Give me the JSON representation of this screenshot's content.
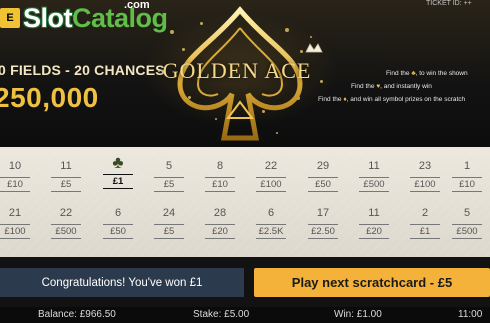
{
  "brand": {
    "tag": "E",
    "name_prefix": "Slot",
    "name_suffix": "Catalog",
    "domain": ".com"
  },
  "ticket_id": "TICKET ID: ++",
  "header": {
    "fields_text": "0 FIELDS - 20 CHANCES",
    "top_prize": "250,000",
    "game_title": "GOLDEN ACE"
  },
  "rules": [
    {
      "pre": "Find the",
      "icon": "♣",
      "post": ", to win the shown"
    },
    {
      "pre": "Find the",
      "icon": "♥",
      "post": ", and instantly win"
    },
    {
      "pre": "Find the",
      "icon": "♦",
      "post": ", and win all symbol prizes on the scratch"
    }
  ],
  "grid": {
    "rows": [
      [
        {
          "symbol": "10",
          "prize": "£10"
        },
        {
          "symbol": "11",
          "prize": "£5"
        },
        {
          "symbol": "♣",
          "prize": "£1",
          "winning": true
        },
        {
          "symbol": "5",
          "prize": "£5"
        },
        {
          "symbol": "8",
          "prize": "£10"
        },
        {
          "symbol": "22",
          "prize": "£100"
        },
        {
          "symbol": "29",
          "prize": "£50"
        },
        {
          "symbol": "11",
          "prize": "£500"
        },
        {
          "symbol": "23",
          "prize": "£100"
        },
        {
          "symbol": "1",
          "prize": "£10"
        }
      ],
      [
        {
          "symbol": "21",
          "prize": "£100"
        },
        {
          "symbol": "22",
          "prize": "£500"
        },
        {
          "symbol": "6",
          "prize": "£50"
        },
        {
          "symbol": "24",
          "prize": "£5"
        },
        {
          "symbol": "28",
          "prize": "£20"
        },
        {
          "symbol": "6",
          "prize": "£2.5K"
        },
        {
          "symbol": "17",
          "prize": "£2.50"
        },
        {
          "symbol": "11",
          "prize": "£20"
        },
        {
          "symbol": "2",
          "prize": "£1"
        },
        {
          "symbol": "5",
          "prize": "£500"
        }
      ]
    ]
  },
  "message": "Congratulations! You've won £1",
  "play_button": "Play next scratchcard - £5",
  "status": {
    "balance": "Balance: £966.50",
    "stake": "Stake: £5.00",
    "win": "Win: £1.00",
    "time": "11:00"
  },
  "colors": {
    "gold": "#f0c040",
    "button": "#f5b23a",
    "message_bg": "#2c3a4e",
    "board": "#e6e2d8"
  }
}
